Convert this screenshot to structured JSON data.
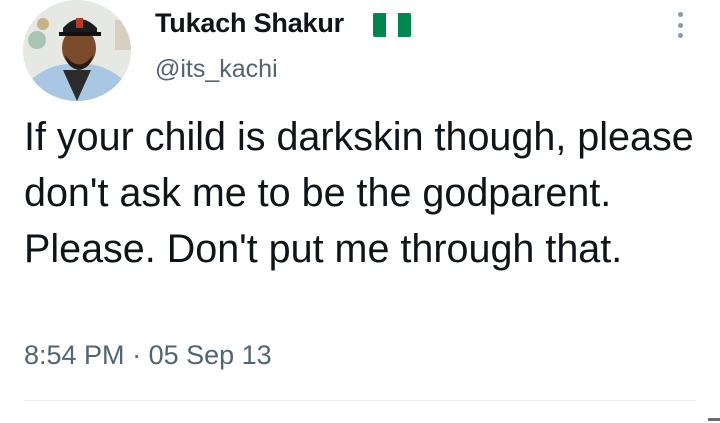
{
  "tweet": {
    "display_name": "Tukach Shakur",
    "handle": "@its_kachi",
    "flag": {
      "name": "nigeria-flag",
      "colors": [
        "#008751",
        "#ffffff",
        "#008751"
      ]
    },
    "text": "If your child is darkskin though, please don't ask me to be the godparent. Please. Don't put me through that.",
    "time": "8:54 PM",
    "separator": "·",
    "date": "05 Sep 13"
  },
  "icons": {
    "more": "more-vertical-icon"
  }
}
